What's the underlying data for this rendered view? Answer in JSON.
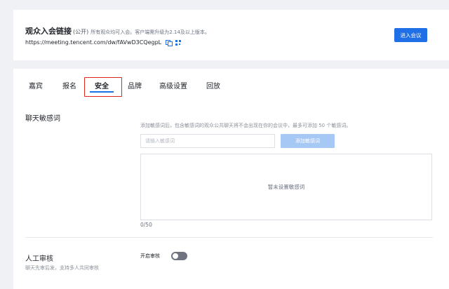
{
  "link_card": {
    "title": "观众入会链接",
    "public_tag": "(公开)",
    "note": "所有观众均可入会。客户端需升级为2.14及以上版本。",
    "url": "https://meeting.tencent.com/dw/fAVwD3CQegpL",
    "join_button": "进入会议"
  },
  "tabs": [
    {
      "label": "嘉宾",
      "active": false
    },
    {
      "label": "报名",
      "active": false
    },
    {
      "label": "安全",
      "active": true
    },
    {
      "label": "品牌",
      "active": false
    },
    {
      "label": "高级设置",
      "active": false
    },
    {
      "label": "回放",
      "active": false
    }
  ],
  "sensitive": {
    "title": "聊天敏感词",
    "hint": "添加敏感词后，包含敏感词的观众公共聊天将不会出现在你的会议中，最多可添加 50 个敏感词。",
    "input_placeholder": "请输入敏感词",
    "add_button": "添加敏感词",
    "empty_text": "暂未设置敏感词",
    "count": "0/50"
  },
  "review": {
    "title": "人工审核",
    "description": "聊天先审后发，支持多人共同审核",
    "toggle_label": "开启审核",
    "toggle_on": false
  },
  "colors": {
    "accent": "#1f6fe6",
    "accent_disabled": "#a6c8f5",
    "highlight": "#e0261d",
    "toggle_off": "#6f7480"
  }
}
